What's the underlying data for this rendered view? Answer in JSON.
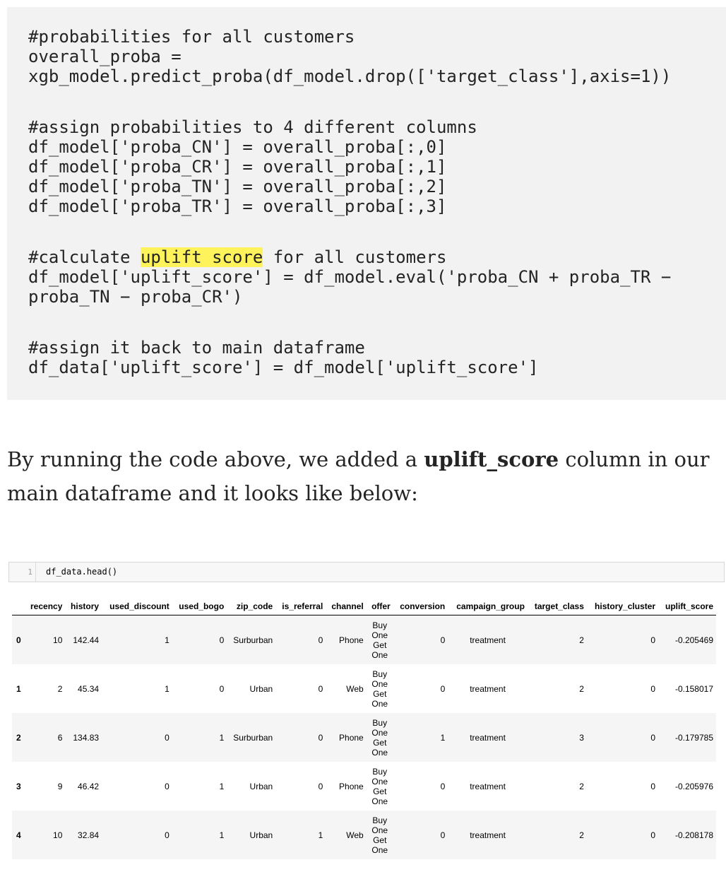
{
  "code": {
    "lines": [
      "#probabilities for all customers",
      "overall_proba =",
      "xgb_model.predict_proba(df_model.drop(['target_class'],axis=1))",
      "#assign probabilities to 4 different columns",
      "df_model['proba_CN'] = overall_proba[:,0]",
      "df_model['proba_CR'] = overall_proba[:,1]",
      "df_model['proba_TN'] = overall_proba[:,2]",
      "df_model['proba_TR'] = overall_proba[:,3]",
      "#calculate ",
      "uplift score",
      " for all customers",
      "df_model['uplift_score'] = df_model.eval('proba_CN + proba_TR −",
      "proba_TN − proba_CR')",
      "#assign it back to main dataframe",
      "df_data['uplift_score'] = df_model['uplift_score']"
    ]
  },
  "prose": {
    "before": "By running the code above, we added a ",
    "bold": "uplift_score",
    "after": " column in our main dataframe and it looks like below:"
  },
  "notebook": {
    "cell_number": "1",
    "cell_code": "df_data.head()"
  },
  "table": {
    "columns": [
      "",
      "recency",
      "history",
      "used_discount",
      "used_bogo",
      "zip_code",
      "is_referral",
      "channel",
      "offer",
      "conversion",
      "campaign_group",
      "target_class",
      "history_cluster",
      "uplift_score"
    ],
    "rows": [
      [
        "0",
        "10",
        "142.44",
        "1",
        "0",
        "Surburban",
        "0",
        "Phone",
        "Buy One Get One",
        "0",
        "treatment",
        "2",
        "0",
        "-0.205469"
      ],
      [
        "1",
        "2",
        "45.34",
        "1",
        "0",
        "Urban",
        "0",
        "Web",
        "Buy One Get One",
        "0",
        "treatment",
        "2",
        "0",
        "-0.158017"
      ],
      [
        "2",
        "6",
        "134.83",
        "0",
        "1",
        "Surburban",
        "0",
        "Phone",
        "Buy One Get One",
        "1",
        "treatment",
        "3",
        "0",
        "-0.179785"
      ],
      [
        "3",
        "9",
        "46.42",
        "0",
        "1",
        "Urban",
        "0",
        "Phone",
        "Buy One Get One",
        "0",
        "treatment",
        "2",
        "0",
        "-0.205976"
      ],
      [
        "4",
        "10",
        "32.84",
        "0",
        "1",
        "Urban",
        "1",
        "Web",
        "Buy One Get One",
        "0",
        "treatment",
        "2",
        "0",
        "-0.208178"
      ]
    ]
  },
  "colors": {
    "code_bg": "#f2f2f2",
    "highlight": "#fff35c"
  }
}
